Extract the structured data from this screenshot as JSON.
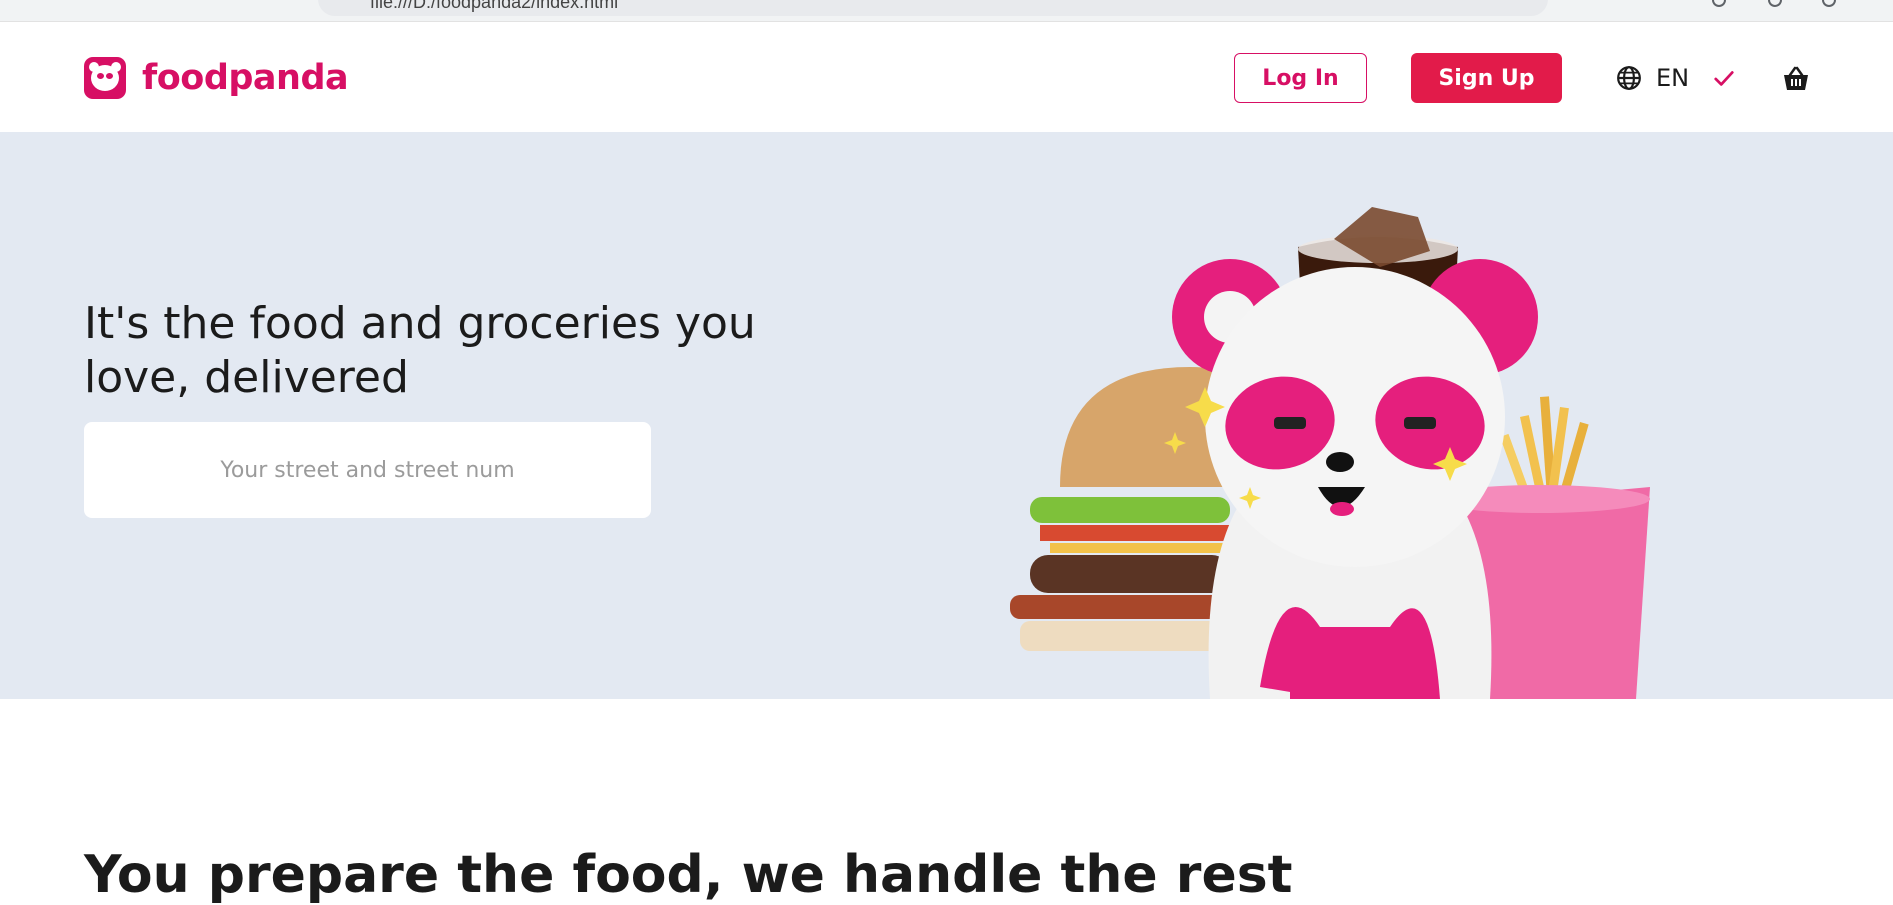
{
  "browser": {
    "url": "file:///D:/foodpanda2/index.html"
  },
  "brand": {
    "name": "foodpanda",
    "color": "#d70f64"
  },
  "header": {
    "login_label": "Log In",
    "signup_label": "Sign Up",
    "language": "EN",
    "icons": [
      "globe-icon",
      "checkmark-icon",
      "cart-icon"
    ]
  },
  "hero": {
    "title": "It's the food and groceries you love, delivered",
    "address_placeholder": "Your street and street num",
    "image": "panda-with-burger-cola-fries"
  },
  "section2": {
    "title": "You prepare the food, we handle the rest"
  },
  "colors": {
    "accent": "#d70f64",
    "signup_bg": "#e21b4a",
    "hero_bg": "#e3e9f2"
  }
}
